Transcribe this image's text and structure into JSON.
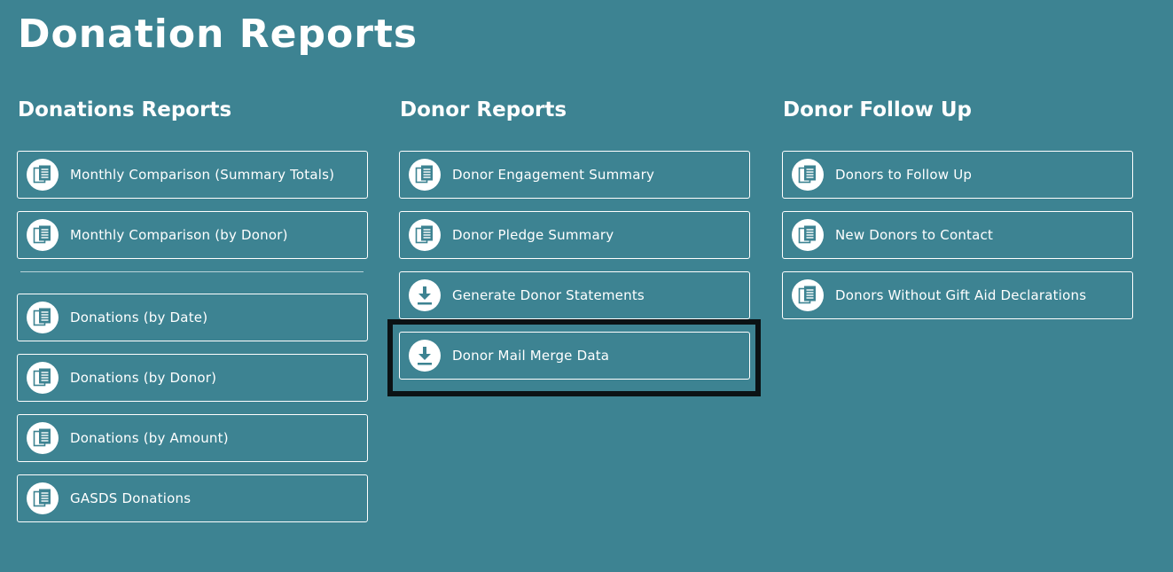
{
  "page": {
    "title": "Donation Reports"
  },
  "columns": [
    {
      "heading": "Donations Reports",
      "groups": [
        [
          {
            "label": "Monthly Comparison (Summary Totals)",
            "icon": "report-icon"
          },
          {
            "label": "Monthly Comparison (by Donor)",
            "icon": "report-icon"
          }
        ],
        [
          {
            "label": "Donations (by Date)",
            "icon": "report-icon"
          },
          {
            "label": "Donations (by Donor)",
            "icon": "report-icon"
          },
          {
            "label": "Donations (by Amount)",
            "icon": "report-icon"
          },
          {
            "label": "GASDS Donations",
            "icon": "report-icon"
          }
        ]
      ]
    },
    {
      "heading": "Donor Reports",
      "groups": [
        [
          {
            "label": "Donor Engagement Summary",
            "icon": "report-icon"
          },
          {
            "label": "Donor Pledge Summary",
            "icon": "report-icon"
          },
          {
            "label": "Generate Donor Statements",
            "icon": "download-icon"
          },
          {
            "label": "Donor Mail Merge Data",
            "icon": "download-icon"
          }
        ]
      ]
    },
    {
      "heading": "Donor Follow Up",
      "groups": [
        [
          {
            "label": "Donors to Follow Up",
            "icon": "report-icon"
          },
          {
            "label": "New Donors to Contact",
            "icon": "report-icon"
          },
          {
            "label": "Donors Without Gift Aid Declarations",
            "icon": "report-icon"
          }
        ]
      ]
    }
  ],
  "colors": {
    "background": "#3d8392",
    "text": "#ffffff",
    "icon_fill": "#3d8392",
    "highlight_border": "#0b1214"
  }
}
